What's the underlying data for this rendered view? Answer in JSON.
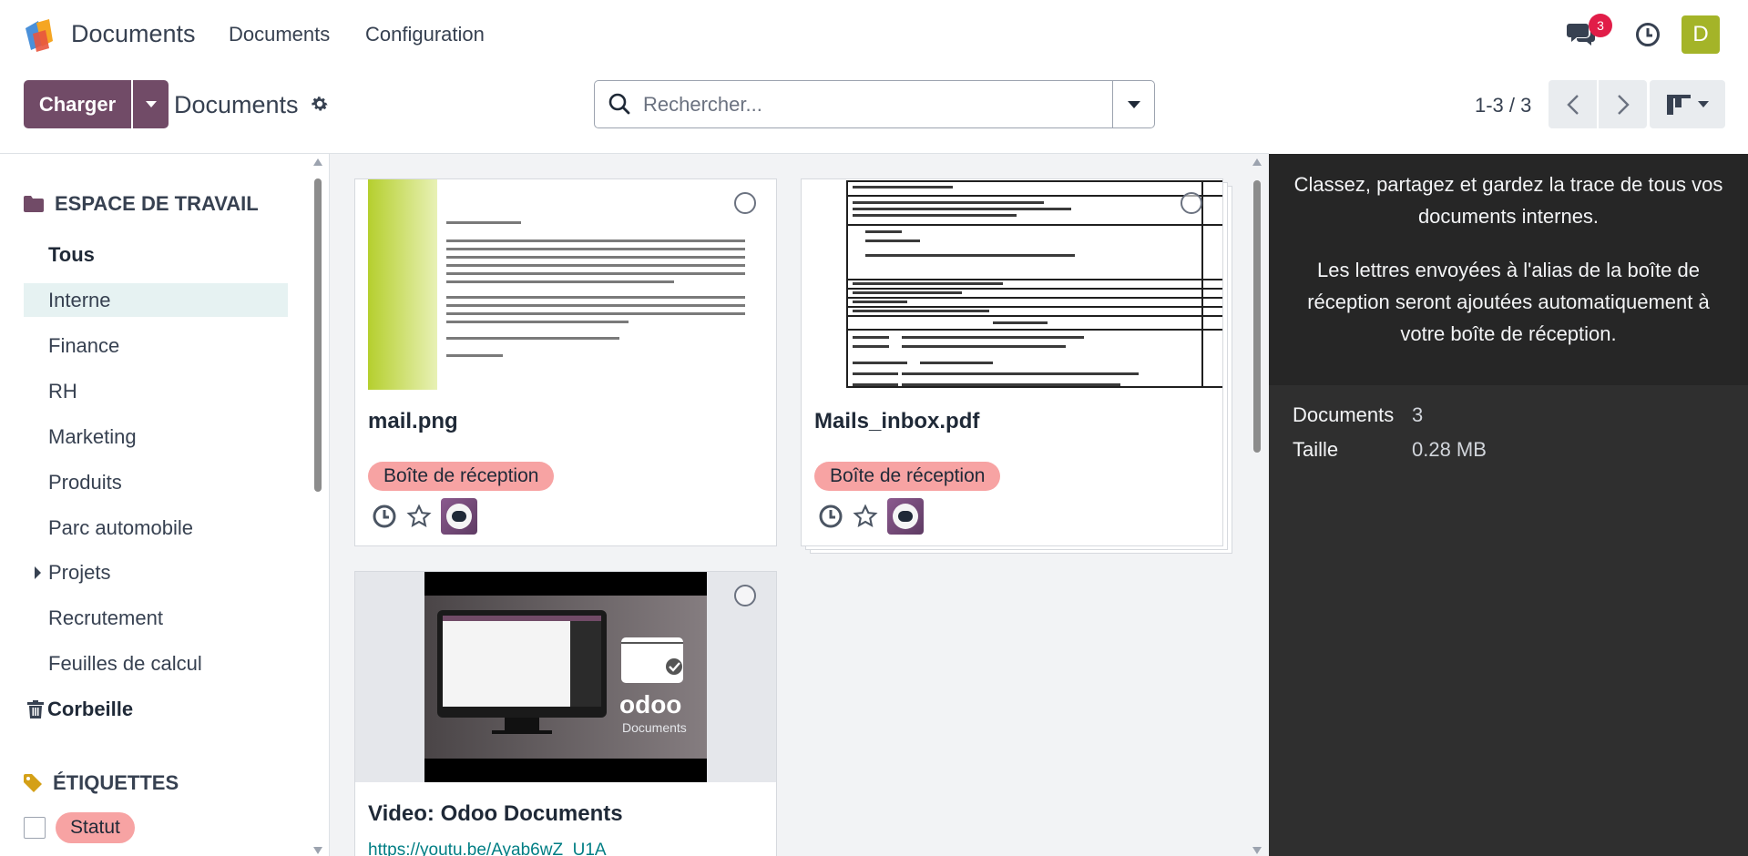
{
  "navbar": {
    "app_name": "Documents",
    "menus": [
      "Documents",
      "Configuration"
    ],
    "messages_count": "3",
    "user_initial": "D"
  },
  "control": {
    "upload_label": "Charger",
    "breadcrumb": "Documents",
    "search_placeholder": "Rechercher...",
    "pager": "1-3 / 3"
  },
  "sidebar": {
    "workspace_title": "ESPACE DE TRAVAIL",
    "items": [
      "Tous",
      "Interne",
      "Finance",
      "RH",
      "Marketing",
      "Produits",
      "Parc automobile",
      "Projets",
      "Recrutement",
      "Feuilles de calcul",
      "Corbeille"
    ],
    "active_item": "Interne",
    "tags_title": "ÉTIQUETTES",
    "tag_label": "Statut"
  },
  "cards": [
    {
      "name": "mail.png",
      "tag": "Boîte de réception"
    },
    {
      "name": "Mails_inbox.pdf",
      "tag": "Boîte de réception"
    },
    {
      "name": "Video: Odoo Documents",
      "link": "https://youtu.be/Ayab6wZ_U1A",
      "video_brand": "odoo",
      "video_caption": "Documents"
    }
  ],
  "info_panel": {
    "text1": "Classez, partagez et gardez la trace de tous vos documents internes.",
    "text2": "Les lettres envoyées à l'alias de la boîte de réception seront ajoutées automatiquement à votre boîte de réception.",
    "documents_label": "Documents",
    "documents_value": "3",
    "size_label": "Taille",
    "size_value": "0.28 MB"
  },
  "colors": {
    "brand": "#714b67",
    "tag": "#f7a3a3",
    "active_item_bg": "#e6f2f2",
    "panel_bg": "#2f2f2f"
  }
}
